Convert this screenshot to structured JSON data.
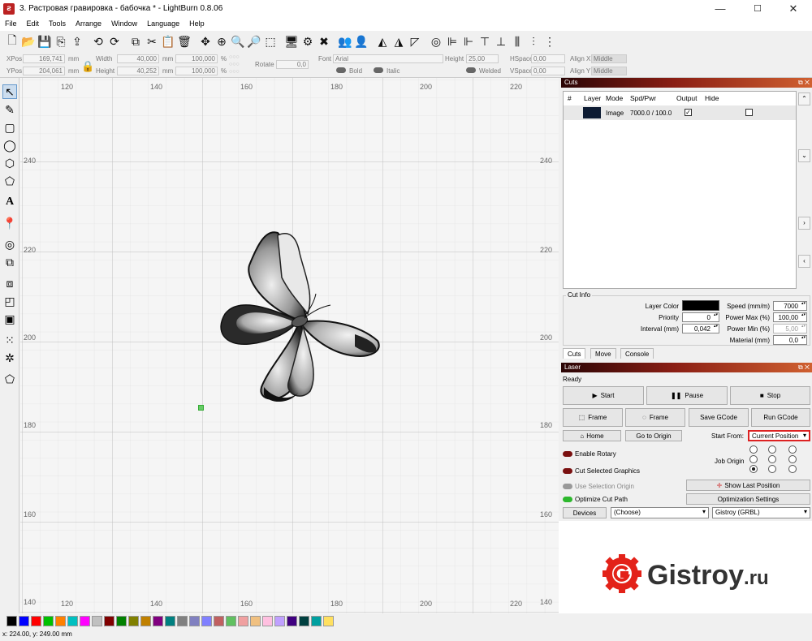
{
  "window": {
    "title": "3. Растровая гравировка - бабочка * - LightBurn 0.8.06",
    "minimize": "—",
    "maximize": "☐",
    "close": "✕"
  },
  "menu": [
    "File",
    "Edit",
    "Tools",
    "Arrange",
    "Window",
    "Language",
    "Help"
  ],
  "props": {
    "xpos_label": "XPos",
    "xpos": "169,741",
    "ypos_label": "YPos",
    "ypos": "204,061",
    "unit": "mm",
    "width_label": "Width",
    "width": "40,000",
    "height_label": "Height",
    "height": "40,252",
    "scale_w": "100,000",
    "scale_h": "100,000",
    "percent": "%",
    "rotate_label": "Rotate",
    "rotate": "0,0",
    "font_label": "Font",
    "font": "Arial",
    "fheight_label": "Height",
    "fheight": "25,00",
    "hspace_label": "HSpace",
    "hspace": "0,00",
    "vspace_label": "VSpace",
    "vspace": "0,00",
    "alignx_label": "Align X",
    "alignx": "Middle",
    "aligny_label": "Align Y",
    "aligny": "Middle",
    "bold": "Bold",
    "italic": "Italic",
    "welded": "Welded"
  },
  "ruler": {
    "top": [
      "120",
      "140",
      "160",
      "180",
      "200",
      "220"
    ],
    "left": [
      "240",
      "220",
      "200",
      "180",
      "160",
      "140"
    ],
    "right": [
      "240",
      "220",
      "200",
      "180",
      "160",
      "140"
    ],
    "bottom": [
      "120",
      "140",
      "160",
      "180",
      "200",
      "220"
    ]
  },
  "cuts": {
    "title": "Cuts",
    "headers": {
      "num": "#",
      "layer": "Layer",
      "mode": "Mode",
      "spdpwr": "Spd/Pwr",
      "output": "Output",
      "hide": "Hide"
    },
    "row": {
      "mode": "Image",
      "spdpwr": "7000.0 / 100.0",
      "color": "#0d1b33",
      "output_checked": true,
      "hide_checked": false
    }
  },
  "cutinfo": {
    "title": "Cut Info",
    "layer_color_label": "Layer Color",
    "layer_color": "#000000",
    "priority_label": "Priority",
    "priority": "0",
    "interval_label": "Interval (mm)",
    "interval": "0,042",
    "speed_label": "Speed (mm/m)",
    "speed": "7000",
    "powermax_label": "Power Max (%)",
    "powermax": "100,00",
    "powermin_label": "Power Min (%)",
    "powermin": "5,00",
    "material_label": "Material (mm)",
    "material": "0,0"
  },
  "tabs": [
    "Cuts",
    "Move",
    "Console"
  ],
  "laser": {
    "title": "Laser",
    "status": "Ready",
    "start": "Start",
    "pause": "Pause",
    "stop": "Stop",
    "frame1": "Frame",
    "frame2": "Frame",
    "save_gcode": "Save GCode",
    "run_gcode": "Run GCode",
    "home": "Home",
    "go_origin": "Go to Origin",
    "start_from_label": "Start From:",
    "start_from": "Current Position",
    "enable_rotary": "Enable Rotary",
    "cut_selected": "Cut Selected Graphics",
    "use_sel_origin": "Use Selection Origin",
    "optimize_cut": "Optimize Cut Path",
    "job_origin": "Job Origin",
    "show_last": "Show Last Position",
    "opt_settings": "Optimization Settings",
    "devices": "Devices",
    "device_select": "(Choose)",
    "profile": "Gistroy (GRBL)"
  },
  "brand": {
    "name": "Gistroy",
    "tld": ".ru",
    "color": "#e32219"
  },
  "palette": [
    "#000000",
    "#0000ff",
    "#ff0000",
    "#00c000",
    "#ff8000",
    "#00c0c0",
    "#ff00ff",
    "#c0c0c0",
    "#800000",
    "#008000",
    "#808000",
    "#c08000",
    "#800080",
    "#008080",
    "#808080",
    "#8080c0",
    "#8080ff",
    "#c06060",
    "#60c060",
    "#f0a0a0",
    "#f0c080",
    "#ffc0e0",
    "#c0a0ff",
    "#400080",
    "#004040",
    "#00a0a0",
    "#ffe060"
  ],
  "status": "x: 224.00, y: 249.00 mm"
}
